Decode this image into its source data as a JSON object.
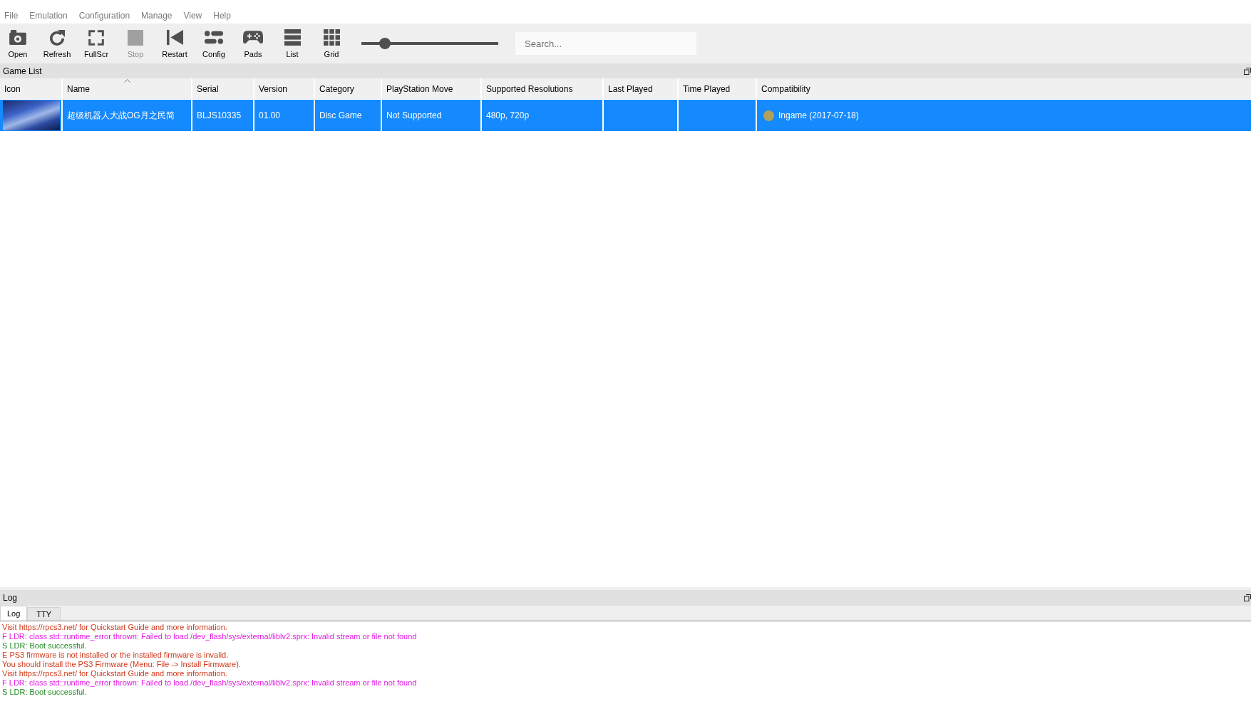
{
  "menu": [
    "File",
    "Emulation",
    "Configuration",
    "Manage",
    "View",
    "Help"
  ],
  "toolbar": {
    "buttons": [
      {
        "label": "Open",
        "disabled": false
      },
      {
        "label": "Refresh",
        "disabled": false
      },
      {
        "label": "FullScr",
        "disabled": false
      },
      {
        "label": "Stop",
        "disabled": true
      },
      {
        "label": "Restart",
        "disabled": false
      },
      {
        "label": "Config",
        "disabled": false
      },
      {
        "label": "Pads",
        "disabled": false
      },
      {
        "label": "List",
        "disabled": false
      },
      {
        "label": "Grid",
        "disabled": false
      }
    ],
    "zoom_slider": {
      "level": 0.17
    },
    "search": {
      "placeholder": "Search..."
    }
  },
  "game_list": {
    "title": "Game List",
    "columns": [
      {
        "label": "Icon",
        "sorted": false
      },
      {
        "label": "Name",
        "sorted": true
      },
      {
        "label": "Serial",
        "sorted": false
      },
      {
        "label": "Version",
        "sorted": false
      },
      {
        "label": "Category",
        "sorted": false
      },
      {
        "label": "PlayStation Move",
        "sorted": false
      },
      {
        "label": "Supported Resolutions",
        "sorted": false
      },
      {
        "label": "Last Played",
        "sorted": false
      },
      {
        "label": "Time Played",
        "sorted": false
      },
      {
        "label": "Compatibility",
        "sorted": false
      }
    ],
    "rows": [
      {
        "selected": true,
        "cells": [
          {
            "kind": "image"
          },
          {
            "kind": "text",
            "text": "超级机器人大战OG月之民简"
          },
          {
            "kind": "text",
            "text": "BLJS10335"
          },
          {
            "kind": "text",
            "text": "01.00"
          },
          {
            "kind": "text",
            "text": "Disc Game"
          },
          {
            "kind": "text",
            "text": "Not Supported"
          },
          {
            "kind": "text",
            "text": "480p, 720p"
          },
          {
            "kind": "blank"
          },
          {
            "kind": "blank"
          },
          {
            "kind": "status",
            "text": "Ingame (2017-07-18)",
            "color": "#b2a15e"
          }
        ]
      }
    ]
  },
  "log": {
    "title": "Log",
    "tabs": [
      {
        "label": "Log",
        "selected": true
      },
      {
        "label": "TTY",
        "selected": false
      }
    ],
    "lines": [
      {
        "text": "Visit https://rpcs3.net/ for Quickstart Guide and more information.",
        "color": "#d0391c"
      },
      {
        "text": "F LDR: class std::runtime_error thrown: Failed to load /dev_flash/sys/external/liblv2.sprx: Invalid stream or file not found",
        "color": "#e619e6"
      },
      {
        "text": "S LDR: Boot successful.",
        "color": "#1f8a1f"
      },
      {
        "text": "E PS3 firmware is not installed or the installed firmware is invalid.",
        "color": "#d0391c"
      },
      {
        "text": "You should install the PS3 Firmware (Menu: File -> Install Firmware).",
        "color": "#d0391c"
      },
      {
        "text": "Visit https://rpcs3.net/ for Quickstart Guide and more information.",
        "color": "#d0391c"
      },
      {
        "text": "F LDR: class std::runtime_error thrown: Failed to load /dev_flash/sys/external/liblv2.sprx: Invalid stream or file not found",
        "color": "#e619e6"
      },
      {
        "text": "S LDR: Boot successful.",
        "color": "#1f8a1f"
      }
    ]
  }
}
